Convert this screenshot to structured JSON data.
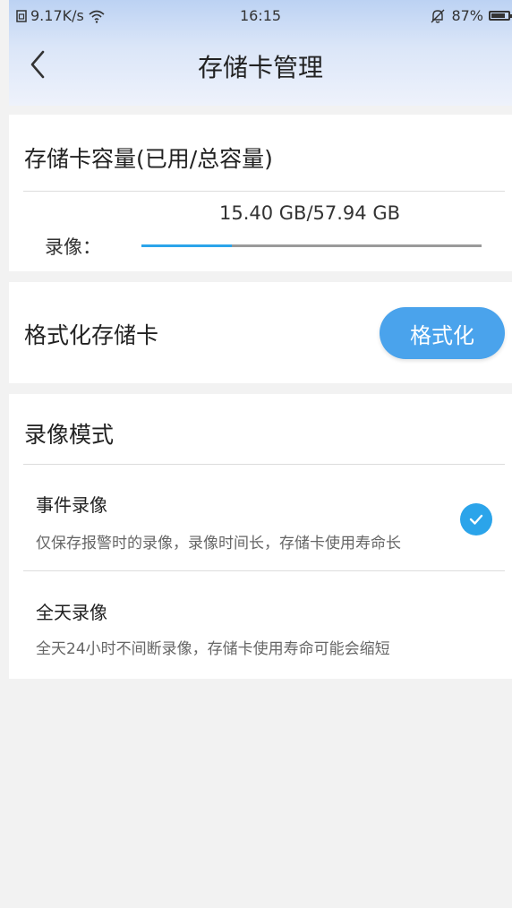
{
  "status_bar": {
    "network_speed": "9.17K/s",
    "time": "16:15",
    "battery": "87%",
    "icons": [
      "sim-icon",
      "wifi-icon",
      "alarm-off-icon",
      "battery-icon"
    ]
  },
  "nav": {
    "title": "存储卡管理",
    "back_icon": "chevron-left-icon"
  },
  "capacity": {
    "title": "存储卡容量(已用/总容量)",
    "used_total": "15.40 GB/57.94 GB",
    "label": "录像：",
    "used_fraction": 0.266
  },
  "format": {
    "title": "格式化存储卡",
    "button_label": "格式化"
  },
  "record_mode": {
    "title": "录像模式",
    "options": [
      {
        "title": "事件录像",
        "desc": "仅保存报警时的录像，录像时间长，存储卡使用寿命长",
        "selected": true
      },
      {
        "title": "全天录像",
        "desc": "全天24小时不间断录像，存储卡使用寿命可能会缩短",
        "selected": false
      }
    ]
  },
  "colors": {
    "accent": "#2ba4ea",
    "button": "#4aa3ec",
    "header_gradient_top": "#bcd2f3"
  }
}
